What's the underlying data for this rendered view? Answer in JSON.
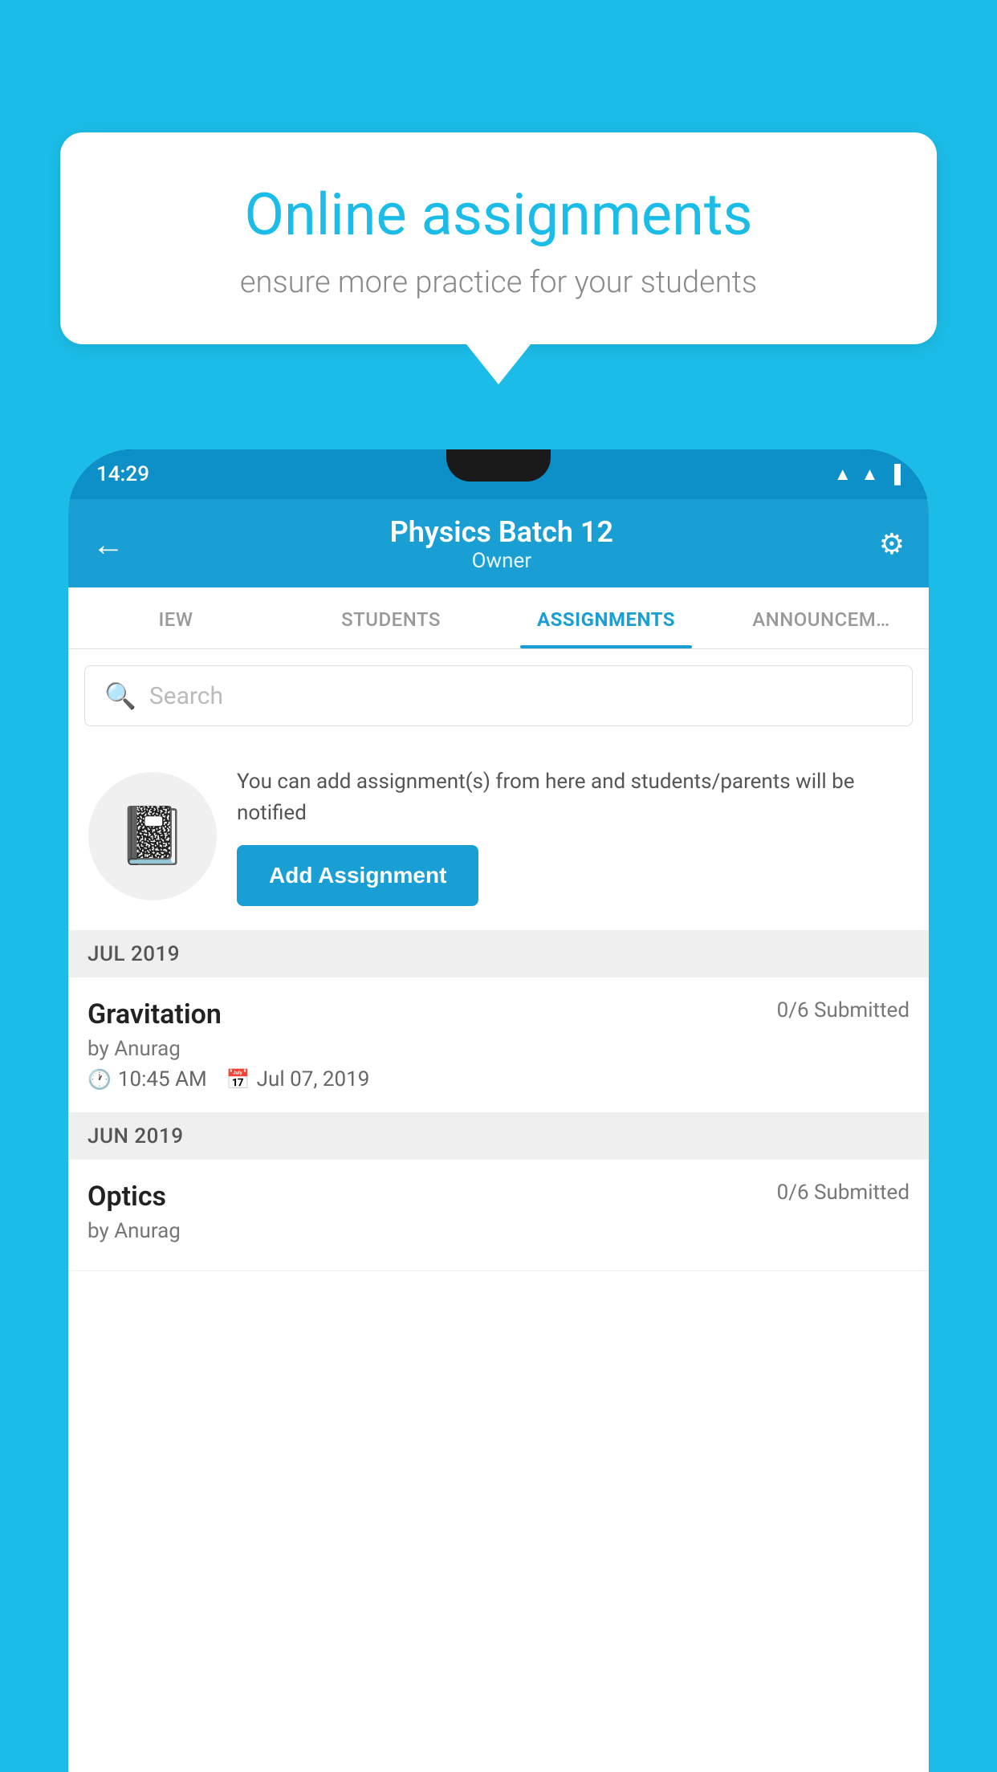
{
  "background_color": "#1BBDE8",
  "speech_bubble": {
    "title": "Online assignments",
    "subtitle": "ensure more practice for your students"
  },
  "status_bar": {
    "time": "14:29",
    "icons": [
      "wifi",
      "signal",
      "battery"
    ]
  },
  "header": {
    "title": "Physics Batch 12",
    "subtitle": "Owner",
    "back_label": "←",
    "settings_label": "⚙"
  },
  "tabs": [
    {
      "label": "IEW",
      "active": false
    },
    {
      "label": "STUDENTS",
      "active": false
    },
    {
      "label": "ASSIGNMENTS",
      "active": true
    },
    {
      "label": "ANNOUNCEM…",
      "active": false
    }
  ],
  "search": {
    "placeholder": "Search"
  },
  "promo": {
    "description": "You can add assignment(s) from here and students/parents will be notified",
    "button_label": "Add Assignment"
  },
  "sections": [
    {
      "month_label": "JUL 2019",
      "assignments": [
        {
          "name": "Gravitation",
          "submitted": "0/6 Submitted",
          "by": "by Anurag",
          "time": "10:45 AM",
          "date": "Jul 07, 2019"
        }
      ]
    },
    {
      "month_label": "JUN 2019",
      "assignments": [
        {
          "name": "Optics",
          "submitted": "0/6 Submitted",
          "by": "by Anurag",
          "time": "",
          "date": ""
        }
      ]
    }
  ]
}
